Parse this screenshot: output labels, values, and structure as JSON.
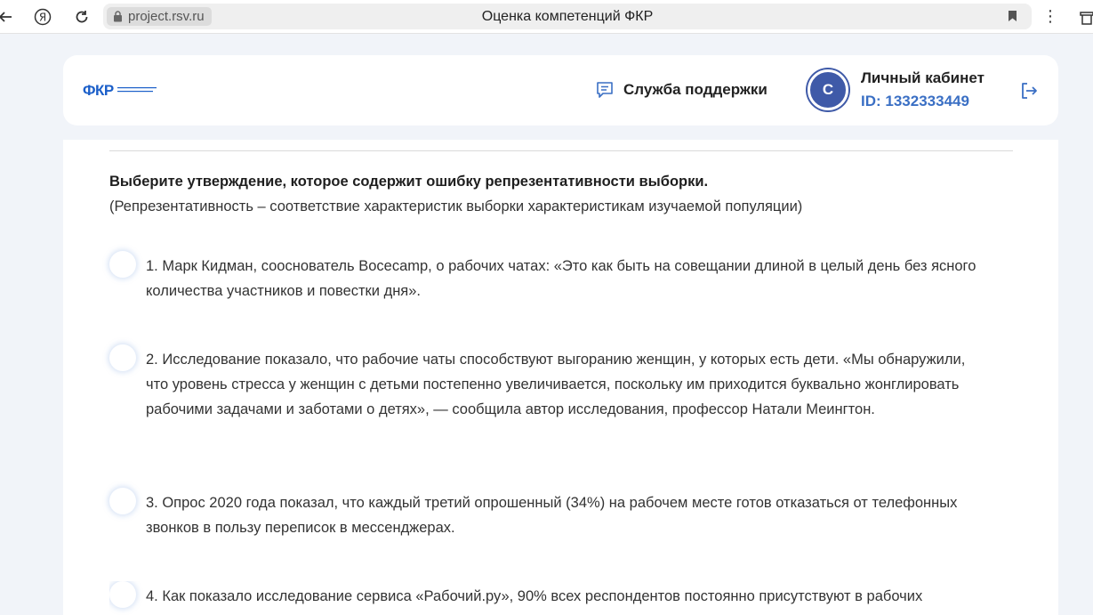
{
  "browser": {
    "domain": "project.rsv.ru",
    "tab_title": "Оценка компетенций ФКР",
    "back_icon": "arrow-left-icon",
    "yandex_icon": "yandex-icon",
    "reload_icon": "reload-icon",
    "menu_glyph": "⋮"
  },
  "header": {
    "logo_text": "ФКР",
    "support_label": "Служба поддержки",
    "avatar_letter": "С",
    "cabinet_title": "Личный кабинет",
    "cabinet_id": "ID: 1332333449"
  },
  "question": {
    "title": "Выберите утверждение, которое содержит ошибку репрезентативности выборки.",
    "note": "(Репрезентативность – соответствие характеристик выборки характеристикам изучаемой популяции)",
    "options": [
      "1. Марк Кидман, сооснователь Bocecamp, о рабочих чатах: «Это как быть на совещании длиной в целый день без ясного количества участников и повестки дня».",
      "2. Исследование показало, что рабочие чаты способствуют выгоранию женщин, у которых есть дети. «Мы обнаружили, что уровень стресса у женщин с детьми постепенно увеличивается, поскольку им приходится буквально жонглировать рабочими задачами и заботами о детях», — сообщила автор исследования, профессор Натали Меингтон.",
      "3. Опрос 2020 года показал, что каждый третий опрошенный (34%) на рабочем месте готов отказаться от телефонных звонков в пользу переписок в мессенджерах.",
      "4. Как показало исследование сервиса «Рабочий.ру», 90% всех респондентов постоянно присутствуют в рабочих"
    ]
  },
  "colors": {
    "accent": "#3f5aa8",
    "id_blue": "#3a6fc4",
    "logo_blue": "#1b5fc9",
    "page_bg": "#f1f4f9"
  }
}
